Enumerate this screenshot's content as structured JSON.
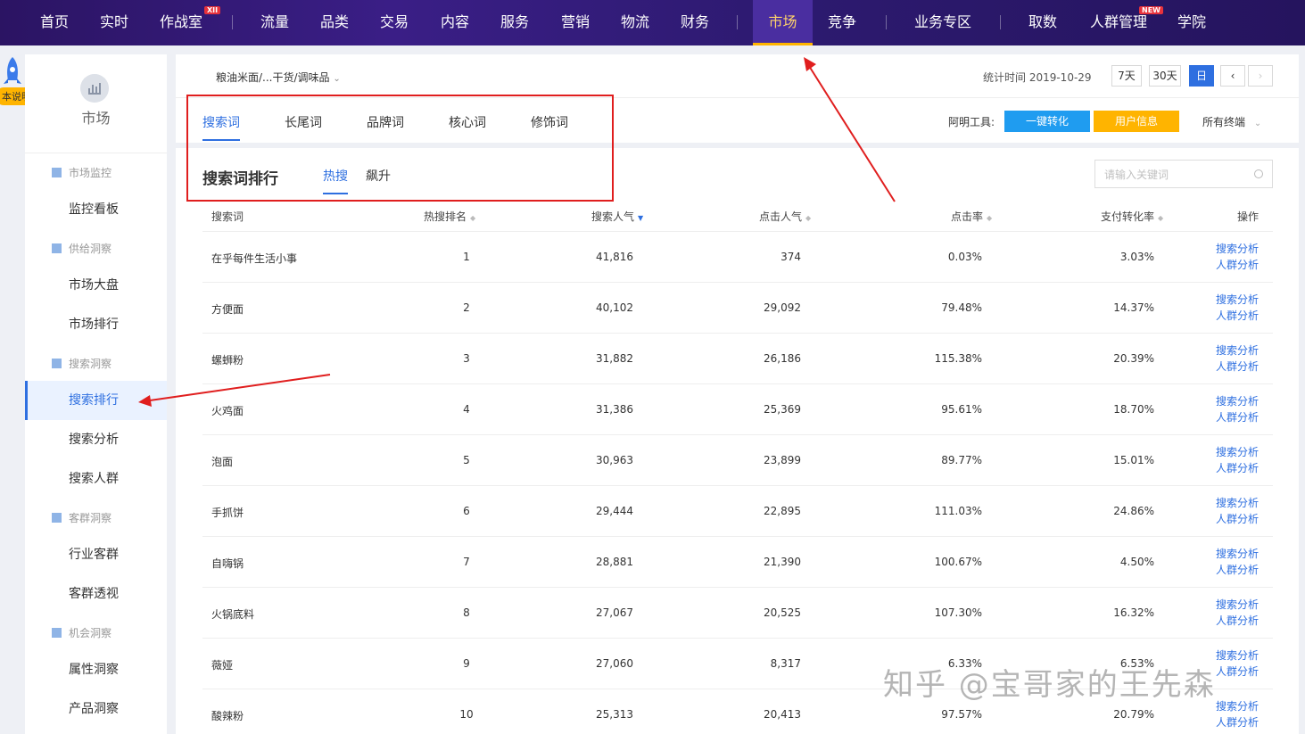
{
  "topnav": {
    "items": [
      "首页",
      "实时",
      "作战室",
      "流量",
      "品类",
      "交易",
      "内容",
      "服务",
      "营销",
      "物流",
      "财务",
      "市场",
      "竞争",
      "业务专区",
      "取数",
      "人群管理",
      "学院"
    ],
    "active": "市场",
    "badge_xii": "XII",
    "badge_new": "NEW"
  },
  "rail": {
    "label": "本说明"
  },
  "sidebar": {
    "title": "市场",
    "groups": [
      {
        "label": "市场监控",
        "items": [
          "监控看板"
        ]
      },
      {
        "label": "供给洞察",
        "items": [
          "市场大盘",
          "市场排行"
        ]
      },
      {
        "label": "搜索洞察",
        "items": [
          "搜索排行",
          "搜索分析",
          "搜索人群"
        ]
      },
      {
        "label": "客群洞察",
        "items": [
          "行业客群",
          "客群透视"
        ]
      },
      {
        "label": "机会洞察",
        "items": [
          "属性洞察",
          "产品洞察"
        ]
      }
    ],
    "active": "搜索排行"
  },
  "header": {
    "breadcrumb": "粮油米面/...干货/调味品",
    "stat_time": "统计时间 2019-10-29",
    "period_buttons": [
      "7天",
      "30天",
      "日"
    ],
    "active_period": "日"
  },
  "tabs": {
    "items": [
      "搜索词",
      "长尾词",
      "品牌词",
      "核心词",
      "修饰词"
    ],
    "active": "搜索词"
  },
  "tools": {
    "label": "阿明工具:",
    "convert": "一键转化",
    "user_info": "用户信息",
    "devices": "所有终端"
  },
  "section": {
    "title": "搜索词排行",
    "subtabs": [
      "热搜",
      "飙升"
    ],
    "active_subtab": "热搜",
    "search_placeholder": "请输入关键词"
  },
  "table": {
    "columns": [
      "搜索词",
      "热搜排名",
      "搜索人气",
      "点击人气",
      "点击率",
      "支付转化率",
      "操作"
    ],
    "action_links": [
      "搜索分析",
      "人群分析"
    ],
    "rows": [
      [
        "在乎每件生活小事",
        "1",
        "41,816",
        "374",
        "0.03%",
        "3.03%"
      ],
      [
        "方便面",
        "2",
        "40,102",
        "29,092",
        "79.48%",
        "14.37%"
      ],
      [
        "螺蛳粉",
        "3",
        "31,882",
        "26,186",
        "115.38%",
        "20.39%"
      ],
      [
        "火鸡面",
        "4",
        "31,386",
        "25,369",
        "95.61%",
        "18.70%"
      ],
      [
        "泡面",
        "5",
        "30,963",
        "23,899",
        "89.77%",
        "15.01%"
      ],
      [
        "手抓饼",
        "6",
        "29,444",
        "22,895",
        "111.03%",
        "24.86%"
      ],
      [
        "自嗨锅",
        "7",
        "28,881",
        "21,390",
        "100.67%",
        "4.50%"
      ],
      [
        "火锅底料",
        "8",
        "27,067",
        "20,525",
        "107.30%",
        "16.32%"
      ],
      [
        "薇娅",
        "9",
        "27,060",
        "8,317",
        "6.33%",
        "6.53%"
      ],
      [
        "酸辣粉",
        "10",
        "25,313",
        "20,413",
        "97.57%",
        "20.79%"
      ]
    ]
  },
  "watermark": "知乎 @宝哥家的王先森",
  "colors": {
    "accent": "#2e6fe0",
    "nav_bg": "#2d1a70",
    "orange": "#ffb400",
    "annotation": "#e01e1e"
  }
}
